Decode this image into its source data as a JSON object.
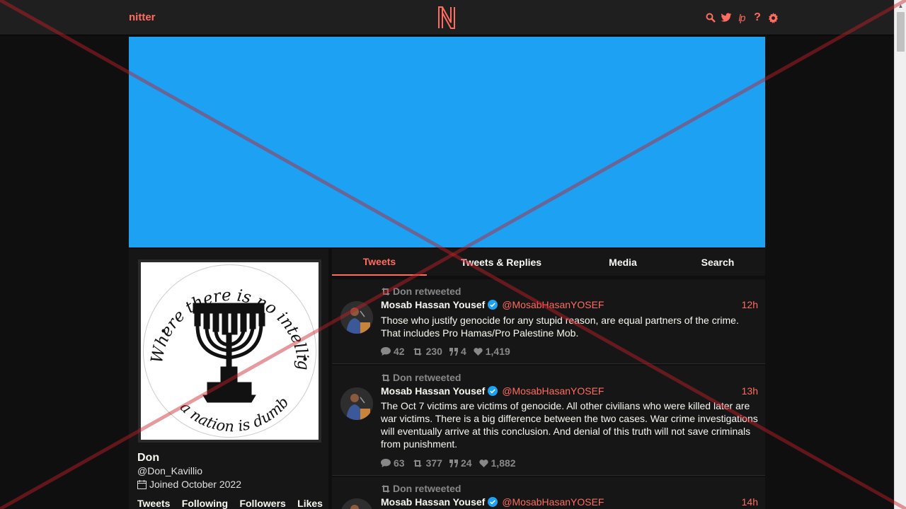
{
  "nav": {
    "brand": "nitter",
    "icons": [
      "search-icon",
      "twitter-bird-icon",
      "liberapay-icon",
      "help-icon",
      "settings-gear-icon"
    ],
    "help_label": "?",
    "liberapay_label": "lp"
  },
  "banner": {
    "color": "#1da1f2"
  },
  "profile": {
    "avatar_text_top": "Where there is no intelligence",
    "avatar_text_bottom": "a nation is dumb",
    "fullname": "Don",
    "username": "@Don_Kavillio",
    "joined": "Joined October 2022",
    "stats": [
      "Tweets",
      "Following",
      "Followers",
      "Likes"
    ]
  },
  "tabs": [
    "Tweets",
    "Tweets & Replies",
    "Media",
    "Search"
  ],
  "tweets": [
    {
      "retweet_header": "Don retweeted",
      "name": "Mosab Hassan Yousef",
      "handle": "@MosabHasanYOSEF",
      "time": "12h",
      "text": "Those who justify genocide for any stupid reason, are equal partners of the crime. That includes Pro Hamas/Pro Palestine Mob.",
      "replies": "42",
      "retweets": "230",
      "quotes": "4",
      "likes": "1,419"
    },
    {
      "retweet_header": "Don retweeted",
      "name": "Mosab Hassan Yousef",
      "handle": "@MosabHasanYOSEF",
      "time": "13h",
      "text": "The Oct 7 victims are victims of genocide. All other civilians who were killed later are war victims. There is a big difference between the two cases. War crime investigations will eventually arrive at this conclusion. And denial of this truth will not save criminals from punishment.",
      "replies": "63",
      "retweets": "377",
      "quotes": "24",
      "likes": "1,882"
    },
    {
      "retweet_header": "Don retweeted",
      "name": "Mosab Hassan Yousef",
      "handle": "@MosabHasanYOSEF",
      "time": "14h",
      "text": "",
      "replies": "",
      "retweets": "",
      "quotes": "",
      "likes": ""
    }
  ],
  "colors": {
    "accent": "#ff6c60",
    "background": "#0f0f0f",
    "panel": "#161616",
    "muted": "#888889",
    "verified": "#1da1f2"
  }
}
